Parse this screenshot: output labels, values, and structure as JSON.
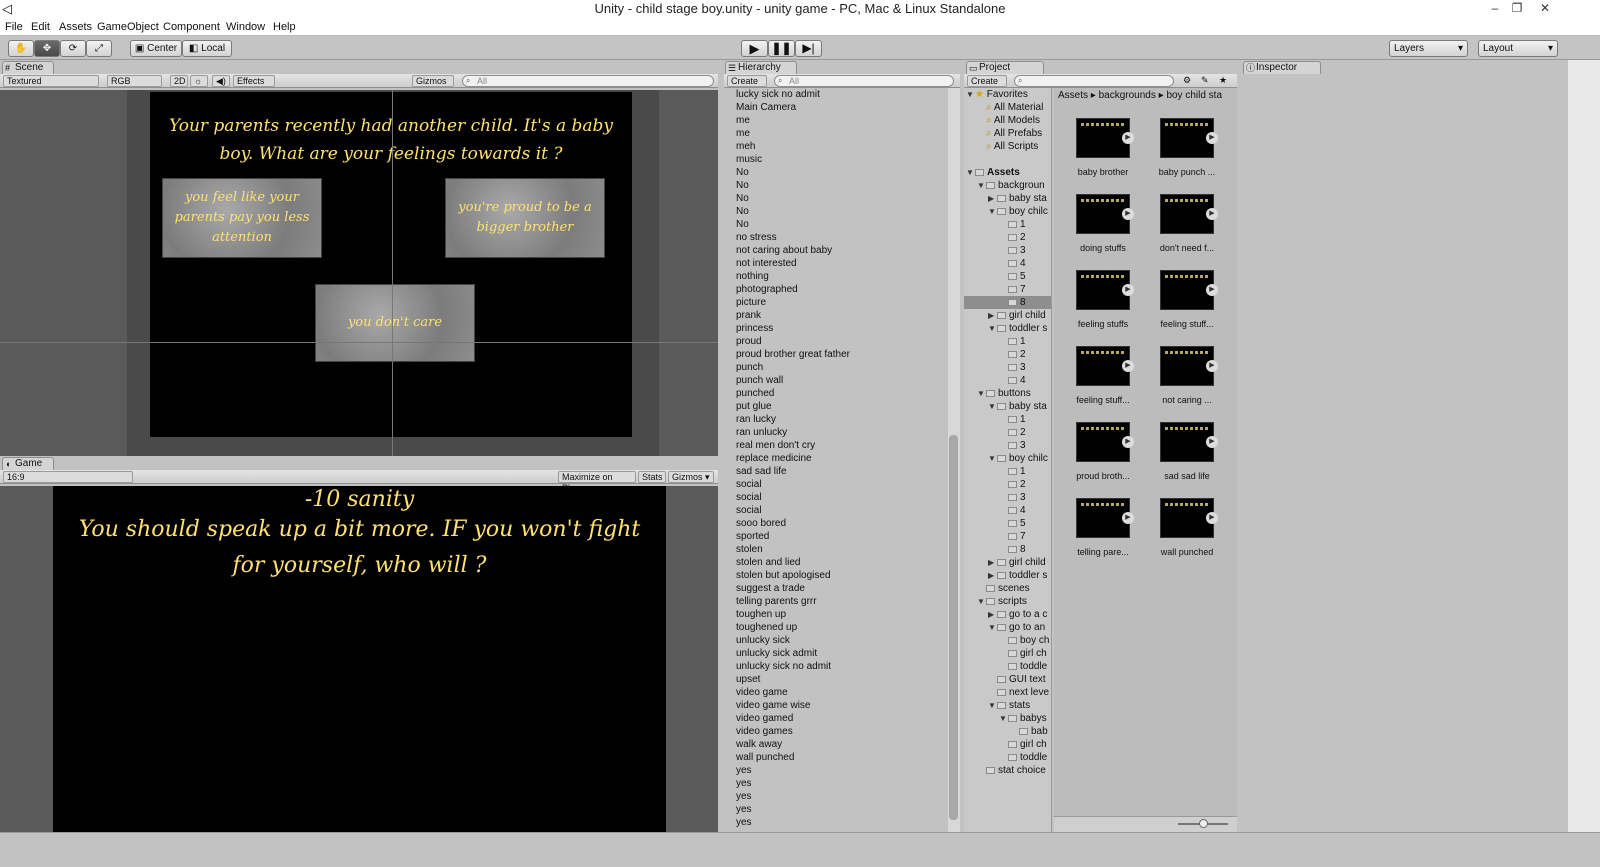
{
  "window": {
    "title": "Unity - child stage boy.unity - unity game - PC, Mac & Linux Standalone",
    "minimize": "–",
    "restore": "❐",
    "close": "✕"
  },
  "menu": [
    "File",
    "Edit",
    "Assets",
    "GameObject",
    "Component",
    "Window",
    "Help"
  ],
  "toolbar": {
    "center": "Center",
    "local": "Local",
    "layers": "Layers",
    "layout": "Layout"
  },
  "scene": {
    "tab": "Scene",
    "shading": "Textured",
    "rgb": "RGB",
    "mode2d": "2D",
    "effects": "Effects",
    "gizmos": "Gizmos",
    "search_placeholder": "All",
    "question": "Your parents recently had another child. It's a baby boy. What are your feelings towards it ?",
    "buttons": [
      "you feel like your parents pay you less attention",
      "you're proud to be a bigger brother",
      "you don't care"
    ]
  },
  "game": {
    "tab": "Game",
    "aspect": "16:9",
    "maximize": "Maximize on Play",
    "stats": "Stats",
    "gizmos": "Gizmos",
    "line1": "-10 sanity",
    "line2": "You should speak up a bit more. IF you won't fight for yourself, who will ?"
  },
  "hierarchy": {
    "tab": "Hierarchy",
    "create": "Create",
    "search_placeholder": "All",
    "items": [
      "lucky sick no admit",
      "Main Camera",
      "me",
      "me",
      "meh",
      "music",
      "No",
      "No",
      "No",
      "No",
      "No",
      "no stress",
      "not caring about baby",
      "not interested",
      "nothing",
      "photographed",
      "picture",
      "prank",
      "princess",
      "proud",
      "proud brother great father",
      "punch",
      "punch wall",
      "punched",
      "put glue",
      "ran lucky",
      "ran unlucky",
      "real men don't cry",
      "replace medicine",
      "sad sad life",
      "social",
      "social",
      "social",
      "sooo bored",
      "sported",
      "stolen",
      "stolen and lied",
      "stolen but apologised",
      "suggest a trade",
      "telling parents grrr",
      "toughen up",
      "toughened up",
      "unlucky sick",
      "unlucky sick admit",
      "unlucky sick no admit",
      "upset",
      "video game",
      "video game wise",
      "video gamed",
      "video games",
      "walk away",
      "wall punched",
      "yes",
      "yes",
      "yes",
      "yes",
      "yes"
    ]
  },
  "project": {
    "tab": "Project",
    "create": "Create",
    "breadcrumb": [
      "Assets",
      "backgrounds",
      "boy child sta"
    ],
    "tree": [
      {
        "label": "Favorites",
        "indent": 0,
        "tri": "▼",
        "kind": "star"
      },
      {
        "label": "All Material",
        "indent": 1,
        "kind": "search"
      },
      {
        "label": "All Models",
        "indent": 1,
        "kind": "search"
      },
      {
        "label": "All Prefabs",
        "indent": 1,
        "kind": "search"
      },
      {
        "label": "All Scripts",
        "indent": 1,
        "kind": "search"
      },
      {
        "label": "",
        "indent": 0,
        "kind": "gap"
      },
      {
        "label": "Assets",
        "indent": 0,
        "tri": "▼",
        "kind": "folder",
        "bold": true
      },
      {
        "label": "backgroun",
        "indent": 1,
        "tri": "▼",
        "kind": "folder"
      },
      {
        "label": "baby sta",
        "indent": 2,
        "tri": "▶",
        "kind": "folder"
      },
      {
        "label": "boy chilc",
        "indent": 2,
        "tri": "▼",
        "kind": "folder"
      },
      {
        "label": "1",
        "indent": 3,
        "kind": "folder"
      },
      {
        "label": "2",
        "indent": 3,
        "kind": "folder"
      },
      {
        "label": "3",
        "indent": 3,
        "kind": "folder"
      },
      {
        "label": "4",
        "indent": 3,
        "kind": "folder"
      },
      {
        "label": "5",
        "indent": 3,
        "kind": "folder"
      },
      {
        "label": "7",
        "indent": 3,
        "kind": "folder"
      },
      {
        "label": "8",
        "indent": 3,
        "kind": "folder",
        "selected": true
      },
      {
        "label": "girl child",
        "indent": 2,
        "tri": "▶",
        "kind": "folder"
      },
      {
        "label": "toddler s",
        "indent": 2,
        "tri": "▼",
        "kind": "folder"
      },
      {
        "label": "1",
        "indent": 3,
        "kind": "folder"
      },
      {
        "label": "2",
        "indent": 3,
        "kind": "folder"
      },
      {
        "label": "3",
        "indent": 3,
        "kind": "folder"
      },
      {
        "label": "4",
        "indent": 3,
        "kind": "folder"
      },
      {
        "label": "buttons",
        "indent": 1,
        "tri": "▼",
        "kind": "folder"
      },
      {
        "label": "baby sta",
        "indent": 2,
        "tri": "▼",
        "kind": "folder"
      },
      {
        "label": "1",
        "indent": 3,
        "kind": "folder"
      },
      {
        "label": "2",
        "indent": 3,
        "kind": "folder"
      },
      {
        "label": "3",
        "indent": 3,
        "kind": "folder"
      },
      {
        "label": "boy chilc",
        "indent": 2,
        "tri": "▼",
        "kind": "folder"
      },
      {
        "label": "1",
        "indent": 3,
        "kind": "folder"
      },
      {
        "label": "2",
        "indent": 3,
        "kind": "folder"
      },
      {
        "label": "3",
        "indent": 3,
        "kind": "folder"
      },
      {
        "label": "4",
        "indent": 3,
        "kind": "folder"
      },
      {
        "label": "5",
        "indent": 3,
        "kind": "folder"
      },
      {
        "label": "7",
        "indent": 3,
        "kind": "folder"
      },
      {
        "label": "8",
        "indent": 3,
        "kind": "folder"
      },
      {
        "label": "girl child",
        "indent": 2,
        "tri": "▶",
        "kind": "folder"
      },
      {
        "label": "toddler s",
        "indent": 2,
        "tri": "▶",
        "kind": "folder"
      },
      {
        "label": "scenes",
        "indent": 1,
        "kind": "folder"
      },
      {
        "label": "scripts",
        "indent": 1,
        "tri": "▼",
        "kind": "folder"
      },
      {
        "label": "go to a c",
        "indent": 2,
        "tri": "▶",
        "kind": "folder"
      },
      {
        "label": "go to an",
        "indent": 2,
        "tri": "▼",
        "kind": "folder"
      },
      {
        "label": "boy ch",
        "indent": 3,
        "kind": "folder"
      },
      {
        "label": "girl ch",
        "indent": 3,
        "kind": "folder"
      },
      {
        "label": "toddle",
        "indent": 3,
        "kind": "folder"
      },
      {
        "label": "GUI text",
        "indent": 2,
        "kind": "folder"
      },
      {
        "label": "next leve",
        "indent": 2,
        "kind": "folder"
      },
      {
        "label": "stats",
        "indent": 2,
        "tri": "▼",
        "kind": "folder"
      },
      {
        "label": "babys",
        "indent": 3,
        "tri": "▼",
        "kind": "folder"
      },
      {
        "label": "bab",
        "indent": 4,
        "kind": "folder"
      },
      {
        "label": "girl ch",
        "indent": 3,
        "kind": "folder"
      },
      {
        "label": "toddle",
        "indent": 3,
        "kind": "folder"
      },
      {
        "label": "stat choice",
        "indent": 1,
        "kind": "folder"
      }
    ],
    "assets": [
      "baby brother",
      "baby punch ...",
      "doing stuffs",
      "don't need f...",
      "feeling stuffs",
      "feeling stuff...",
      "feeling stuff...",
      "not caring ...",
      "proud broth...",
      "sad sad life",
      "telling pare...",
      "wall punched"
    ]
  },
  "inspector": {
    "tab": "Inspector"
  }
}
